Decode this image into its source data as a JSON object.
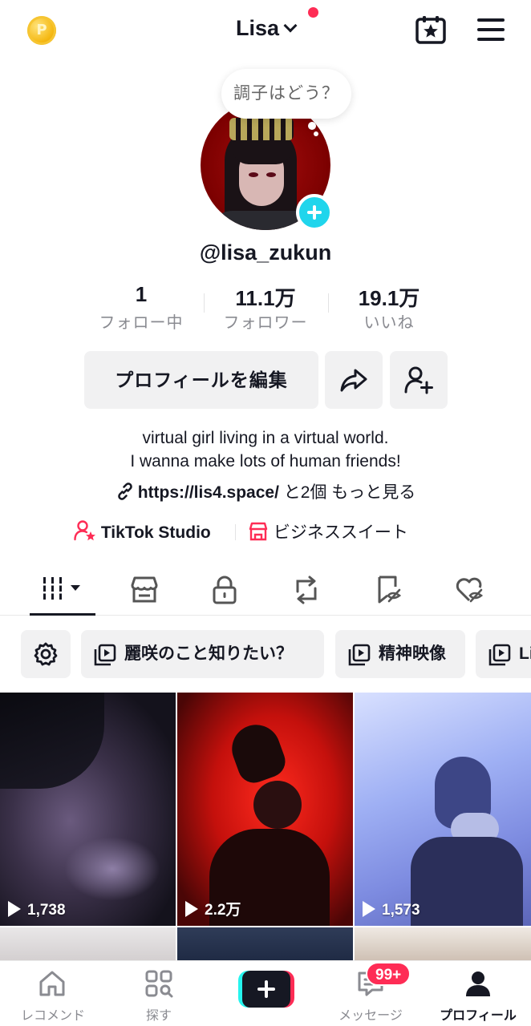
{
  "header": {
    "coin_symbol": "P",
    "username": "Lisa",
    "notification_dot_color": "#fe2c55"
  },
  "status_bubble": {
    "text": "調子はどう？"
  },
  "profile": {
    "handle": "@lisa_zukun",
    "stats": [
      {
        "value": "1",
        "label": "フォロー中"
      },
      {
        "value": "11.1万",
        "label": "フォロワー"
      },
      {
        "value": "19.1万",
        "label": "いいね"
      }
    ],
    "edit_button": "プロフィールを編集",
    "bio_line1": "virtual girl living in a virtual world.",
    "bio_line2": "I wanna make lots of human friends!",
    "link_url": "https://lis4.space/",
    "link_more": "と2個 もっと見る",
    "tools": {
      "studio": "TikTok Studio",
      "business": "ビジネススイート"
    }
  },
  "tabs": [
    {
      "icon": "grid-icon",
      "active": true
    },
    {
      "icon": "shop-icon"
    },
    {
      "icon": "lock-icon"
    },
    {
      "icon": "repost-icon"
    },
    {
      "icon": "saved-hidden-icon"
    },
    {
      "icon": "liked-hidden-icon"
    }
  ],
  "playlists": [
    {
      "label": "麗咲のこと知りたい？"
    },
    {
      "label": "精神映像"
    },
    {
      "label": "Li"
    }
  ],
  "videos": [
    {
      "views": "1,738"
    },
    {
      "views": "2.2万"
    },
    {
      "views": "1,573"
    }
  ],
  "bottom_nav": {
    "items": [
      {
        "label": "レコメンド"
      },
      {
        "label": "探す"
      },
      {
        "label": ""
      },
      {
        "label": "メッセージ",
        "badge": "99+"
      },
      {
        "label": "プロフィール",
        "active": true
      }
    ]
  },
  "colors": {
    "accent": "#fe2c55",
    "cyan": "#20d5ec",
    "text": "#161823",
    "muted": "#8a8b91"
  }
}
